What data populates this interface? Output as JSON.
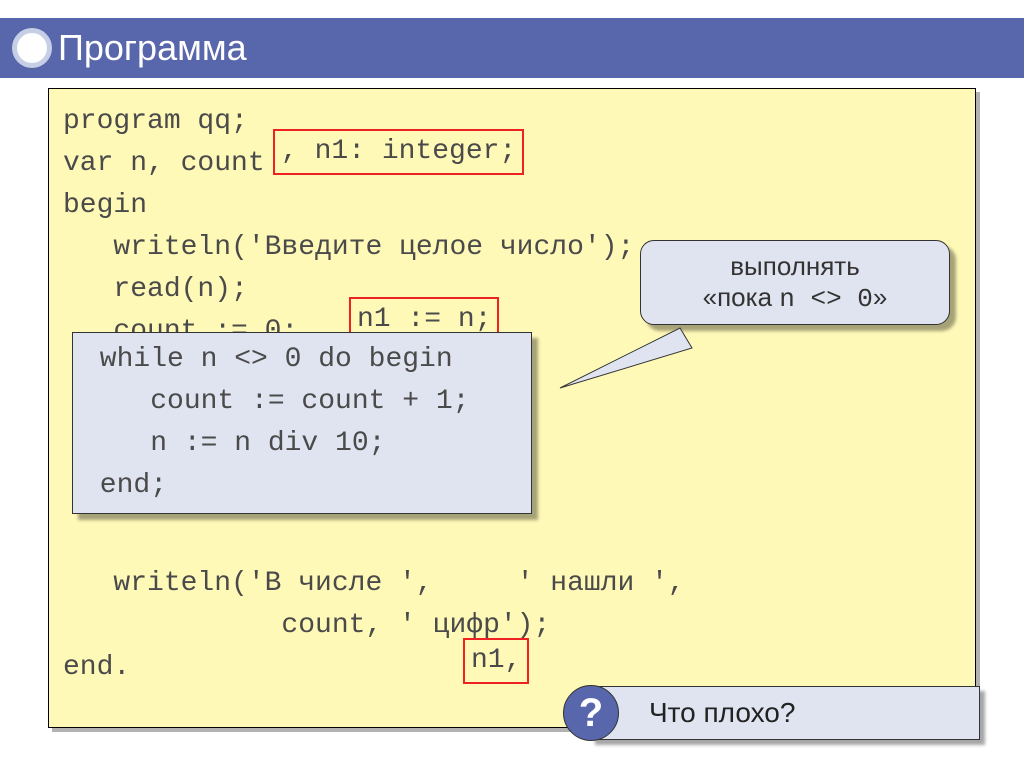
{
  "title": "Программа",
  "code": {
    "l1": "program qq;",
    "l2": "var n, count",
    "hl1": ", n1: integer;",
    "l3": "begin",
    "l4": "   writeln('Введите целое число');",
    "l5a": "   read(n);",
    "hl2": "n1 := n;",
    "l6": "   count := 0;",
    "while1": " while n <> 0 do begin",
    "while2": "    count := count + 1;",
    "while3": "    n := n div 10;",
    "while4": " end;",
    "l11a": "   writeln('В числе ', ",
    "hl3": "n1,",
    "l11b": " ' нашли ',",
    "l12": "             count, ' цифр');",
    "l13": "end."
  },
  "callout": {
    "line1": "выполнять",
    "line2a": "«пока ",
    "line2mono": "n <> 0",
    "line2b": "»"
  },
  "question": {
    "icon": "?",
    "text": "Что плохо?"
  }
}
